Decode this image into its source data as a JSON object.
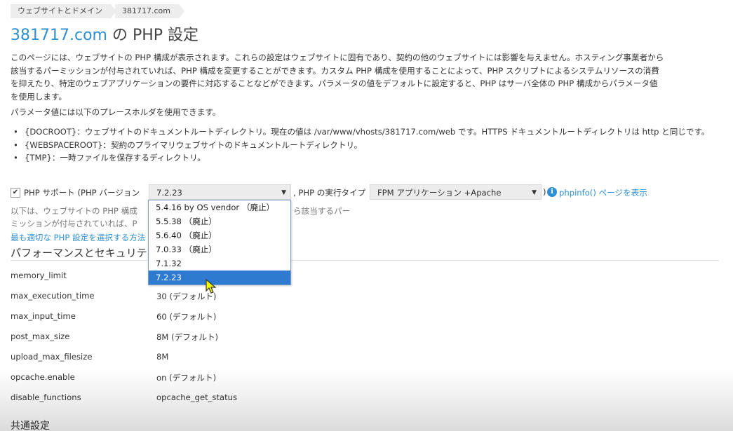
{
  "breadcrumb": [
    "ウェブサイトとドメイン",
    "381717.com"
  ],
  "title": {
    "site": "381717.com",
    "rest": " の PHP 設定"
  },
  "intro": [
    "このページには、ウェブサイトの PHP 構成が表示されます。これらの設定はウェブサイトに固有であり、契約の他のウェブサイトには影響を与えません。ホスティング事業者から",
    "該当するパーミッションが付与されていれば、PHP 構成を変更することができます。カスタム PHP 構成を使用することによって、PHP スクリプトによるシステムリソースの消費",
    "を抑えたり、特定のウェブアプリケーションの要件に対応することなどができます。パラメータの値をデフォルトに設定すると、PHP はサーバ全体の PHP 構成からパラメータ値",
    "を使用します。"
  ],
  "placeholder_intro": "パラメータ値には以下のプレースホルダを使用できます。",
  "placeholders": [
    "{DOCROOT}：ウェブサイトのドキュメントルートディレクトリ。現在の値は /var/www/vhosts/381717.com/web です。HTTPS ドキュメントルートディレクトリは http と同じです。",
    "{WEBSPACEROOT}：契約のプライマリウェブサイトのドキュメントルートディレクトリ。",
    "{TMP}：一時ファイルを保存するディレクトリ。"
  ],
  "php_support": {
    "checked": true,
    "checkmark": "✔",
    "label": "PHP サポート (PHP バージョン",
    "version_value": "7.2.23",
    "exec_label": ", PHP の実行タイプ",
    "exec_value": "FPM アプリケーション +Apache",
    "paren": ")",
    "phpinfo_link": "phpinfo() ページを表示",
    "arrow": "▼",
    "info_icon": "i"
  },
  "version_options": [
    "5.4.16 by OS vendor （廃止）",
    "5.5.38 （廃止）",
    "5.6.40 （廃止）",
    "7.0.33 （廃止）",
    "7.1.32",
    "7.2.23"
  ],
  "selected_option_index": 5,
  "description_left_1": "以下は、ウェブサイトの PHP 構成",
  "description_right_1": "ら該当するパー",
  "description_left_2": "ミッションが付与されていれば、P",
  "best_link": "最も適切な PHP 設定を選択する方法",
  "section_title": "パフォーマンスとセキュリティ",
  "settings": [
    {
      "key": "memory_limit",
      "value": ""
    },
    {
      "key": "max_execution_time",
      "value": "30 (デフォルト)"
    },
    {
      "key": "max_input_time",
      "value": "60 (デフォルト)"
    },
    {
      "key": "post_max_size",
      "value": "8M (デフォルト)"
    },
    {
      "key": "upload_max_filesize",
      "value": "8M"
    },
    {
      "key": "opcache.enable",
      "value": "on (デフォルト)"
    },
    {
      "key": "disable_functions",
      "value": "opcache_get_status"
    }
  ],
  "common_settings": "共通設定",
  "colors": {
    "link": "#2e8fd1",
    "selected": "#2e7ad1"
  }
}
